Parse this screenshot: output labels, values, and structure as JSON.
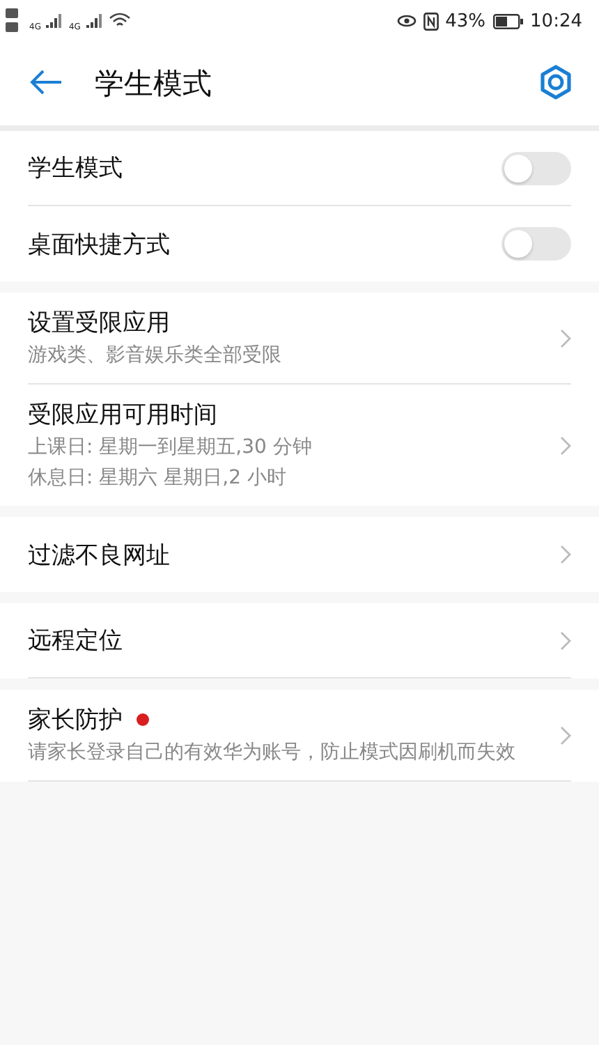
{
  "status_bar": {
    "network": [
      "4G",
      "4G"
    ],
    "battery_percent": "43%",
    "time": "10:24"
  },
  "header": {
    "title": "学生模式"
  },
  "groups": [
    {
      "rows": [
        {
          "kind": "toggle",
          "title": "学生模式",
          "on": false
        },
        {
          "kind": "toggle",
          "title": "桌面快捷方式",
          "on": false
        }
      ]
    },
    {
      "rows": [
        {
          "kind": "link",
          "title": "设置受限应用",
          "subtitle": [
            "游戏类、影音娱乐类全部受限"
          ]
        },
        {
          "kind": "link",
          "title": "受限应用可用时间",
          "subtitle": [
            "上课日: 星期一到星期五,30 分钟",
            "休息日: 星期六 星期日,2 小时"
          ]
        }
      ]
    },
    {
      "rows": [
        {
          "kind": "link",
          "title": "过滤不良网址"
        }
      ]
    },
    {
      "rows": [
        {
          "kind": "link",
          "title": "远程定位"
        }
      ]
    },
    {
      "rows": [
        {
          "kind": "link",
          "title": "家长防护",
          "alert": true,
          "subtitle": [
            "请家长登录自己的有效华为账号，防止模式因刷机而失效"
          ]
        }
      ]
    }
  ]
}
